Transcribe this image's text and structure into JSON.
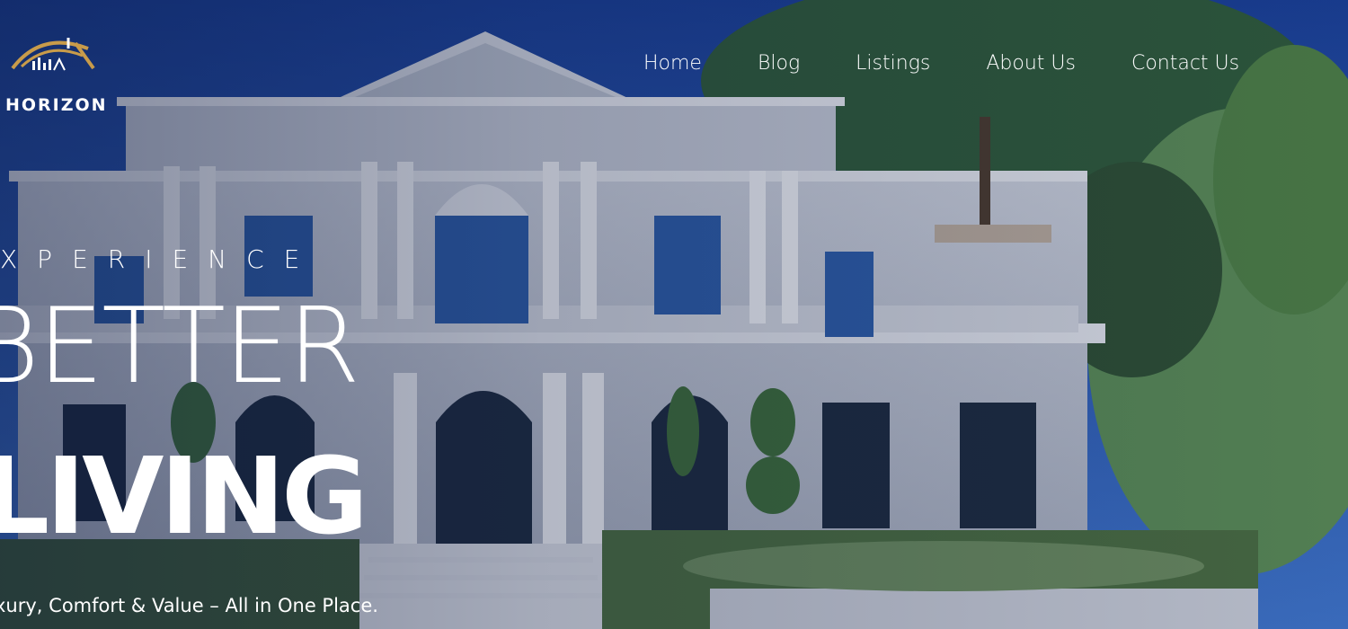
{
  "brand": {
    "name": "HORIZON",
    "logo_icon": "house-roof-bars-logo"
  },
  "nav": {
    "items": [
      {
        "label": "Home"
      },
      {
        "label": "Blog"
      },
      {
        "label": "Listings"
      },
      {
        "label": "About Us"
      },
      {
        "label": "Contact Us"
      }
    ]
  },
  "hero": {
    "eyebrow": "XPERIENCE",
    "headline_1": "BETTER",
    "headline_2": "LIVING",
    "tagline": "xury, Comfort & Value – All in One Place.",
    "image": "luxury-white-mansion-photo"
  },
  "colors": {
    "sky": "#1c4fb0",
    "overlay": "#0a163c",
    "logo_gold": "#c89b4a",
    "text": "#ffffff"
  }
}
